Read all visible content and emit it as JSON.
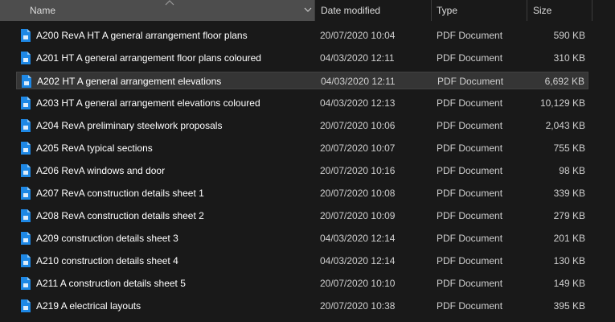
{
  "columns": {
    "name": "Name",
    "date_modified": "Date modified",
    "type": "Type",
    "size": "Size"
  },
  "sort": {
    "column": "name",
    "direction": "ascending",
    "icon": "sort-up-icon"
  },
  "colors": {
    "pdf_icon_blue": "#1e88e5",
    "selected_row": "#353535",
    "header_active": "#4d4d4d"
  },
  "files": [
    {
      "name": "A200 RevA HT A general arrangement floor plans",
      "date": "20/07/2020 10:04",
      "type": "PDF Document",
      "size": "590 KB",
      "selected": false
    },
    {
      "name": "A201 HT A general arrangement floor plans coloured",
      "date": "04/03/2020 12:11",
      "type": "PDF Document",
      "size": "310 KB",
      "selected": false
    },
    {
      "name": "A202 HT A general arrangement elevations",
      "date": "04/03/2020 12:11",
      "type": "PDF Document",
      "size": "6,692 KB",
      "selected": true
    },
    {
      "name": "A203 HT A general arrangement elevations coloured",
      "date": "04/03/2020 12:13",
      "type": "PDF Document",
      "size": "10,129 KB",
      "selected": false
    },
    {
      "name": "A204 RevA preliminary steelwork proposals",
      "date": "20/07/2020 10:06",
      "type": "PDF Document",
      "size": "2,043 KB",
      "selected": false
    },
    {
      "name": "A205 RevA typical sections",
      "date": "20/07/2020 10:07",
      "type": "PDF Document",
      "size": "755 KB",
      "selected": false
    },
    {
      "name": "A206 RevA windows and door",
      "date": "20/07/2020 10:16",
      "type": "PDF Document",
      "size": "98 KB",
      "selected": false
    },
    {
      "name": "A207 RevA construction details sheet 1",
      "date": "20/07/2020 10:08",
      "type": "PDF Document",
      "size": "339 KB",
      "selected": false
    },
    {
      "name": "A208 RevA construction details sheet 2",
      "date": "20/07/2020 10:09",
      "type": "PDF Document",
      "size": "279 KB",
      "selected": false
    },
    {
      "name": "A209 construction details sheet 3",
      "date": "04/03/2020 12:14",
      "type": "PDF Document",
      "size": "201 KB",
      "selected": false
    },
    {
      "name": "A210 construction details sheet 4",
      "date": "04/03/2020 12:14",
      "type": "PDF Document",
      "size": "130 KB",
      "selected": false
    },
    {
      "name": "A211 A construction details sheet 5",
      "date": "20/07/2020 10:10",
      "type": "PDF Document",
      "size": "149 KB",
      "selected": false
    },
    {
      "name": "A219 A electrical layouts",
      "date": "20/07/2020 10:38",
      "type": "PDF Document",
      "size": "395 KB",
      "selected": false
    }
  ]
}
